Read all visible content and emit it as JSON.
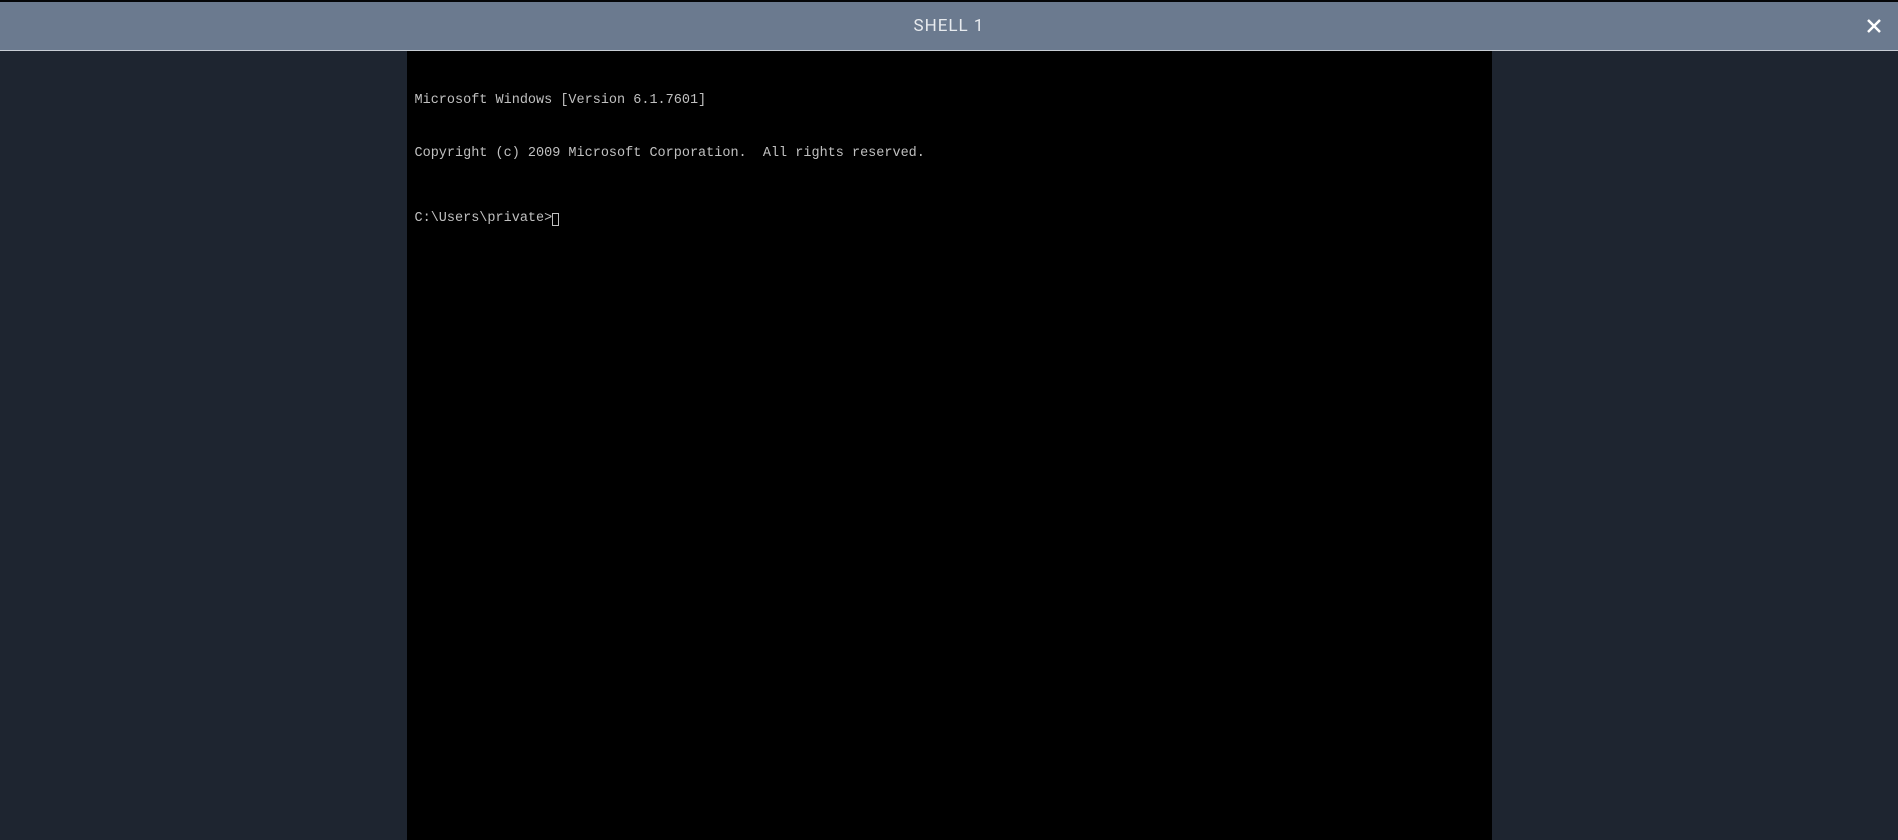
{
  "titlebar": {
    "title": "SHELL 1"
  },
  "terminal": {
    "line1": "Microsoft Windows [Version 6.1.7601]",
    "line2": "Copyright (c) 2009 Microsoft Corporation.  All rights reserved.",
    "prompt": "C:\\Users\\private>"
  }
}
